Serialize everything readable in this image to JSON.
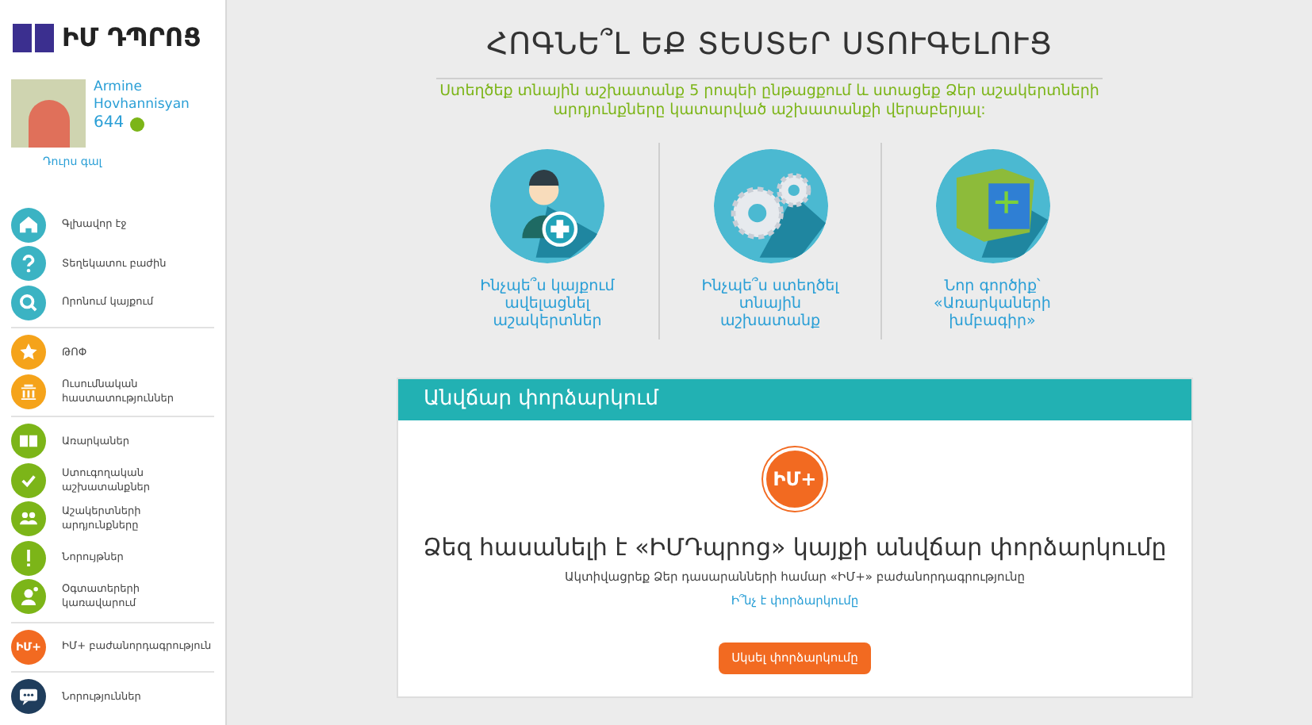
{
  "logo": {
    "text": "ԻՄ ԴՊՐՈՑ"
  },
  "user": {
    "name": "Armine Hovhannisyan",
    "points": "644",
    "logout": "Դուրս գալ"
  },
  "sidebar": {
    "groups": [
      {
        "items": [
          {
            "label": "Գլխավոր էջ",
            "color": "#3bb3c3"
          },
          {
            "label": "Տեղեկատու բաժին",
            "color": "#3bb3c3"
          },
          {
            "label": "Որոնում կայքում",
            "color": "#3bb3c3"
          }
        ]
      },
      {
        "items": [
          {
            "label": "ԹՈՓ",
            "color": "#f5a31a"
          },
          {
            "label": "Ուսումնական հաստատություններ",
            "color": "#f5a31a"
          }
        ]
      },
      {
        "items": [
          {
            "label": "Առարկաներ",
            "color": "#7cb518"
          },
          {
            "label": "Ստուգողական աշխատանքներ",
            "color": "#7cb518"
          },
          {
            "label": "Աշակերտների արդյունքները",
            "color": "#7cb518"
          },
          {
            "label": "Նորույթներ",
            "color": "#7cb518"
          },
          {
            "label": "Օգտատերերի կառավարում",
            "color": "#7cb518"
          }
        ]
      },
      {
        "items": [
          {
            "label": "ԻՄ+ բաժանորդագրություն",
            "color": "#f26a21",
            "badge": "ԻՄ+"
          }
        ]
      },
      {
        "items": [
          {
            "label": "Նորություններ",
            "color": "#1f3d5c"
          }
        ]
      }
    ]
  },
  "hero": {
    "title": "ՀՈԳՆԵ՞Լ ԵՔ ՏԵՍՏԵՐ ՍՏՈՒԳԵԼՈՒՑ",
    "subtitle": "Ստեղծեք տնային աշխատանք 5 րոպեի ընթացքում և ստացեք Ձեր աշակերտների արդյունքները կատարված աշխատանքի վերաբերյալ:"
  },
  "features": [
    {
      "label": "Ինչպե՞ս կայքում ավելացնել աշակերտներ"
    },
    {
      "label": "Ինչպե՞ս ստեղծել տնային աշխատանք"
    },
    {
      "label": "Նոր գործիք՝ «Առարկաների խմբագիր»"
    }
  ],
  "trial": {
    "header": "Անվճար փորձարկում",
    "badge": "ԻՄ+",
    "heading": "Ձեզ հասանելի է «ԻՄԴպրոց» կայքի անվճար փորձարկումը",
    "text": "Ակտիվացրեք Ձեր դասարանների համար «ԻՄ+» բաժանորդագրությունը",
    "link": "Ի՞նչ է փորձարկումը",
    "button": "Սկսել փորձարկումը"
  }
}
